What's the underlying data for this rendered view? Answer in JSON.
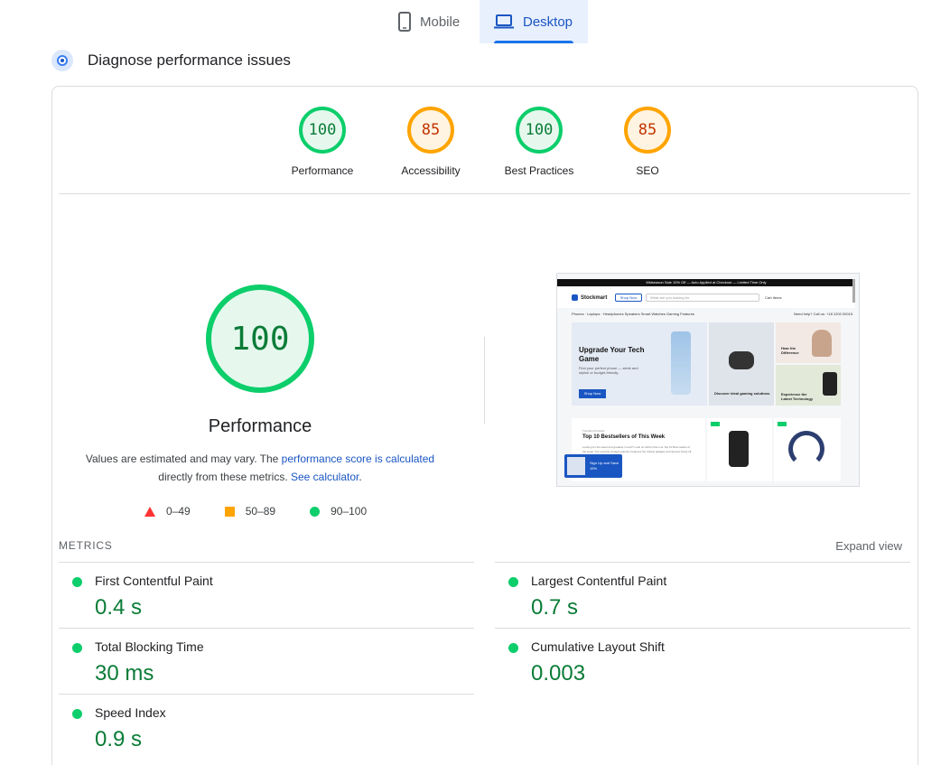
{
  "tabs": {
    "mobile_label": "Mobile",
    "desktop_label": "Desktop"
  },
  "diagnose": {
    "title": "Diagnose performance issues"
  },
  "scores": [
    {
      "label": "Performance",
      "value": "100",
      "color": "#0cce6b"
    },
    {
      "label": "Accessibility",
      "value": "85",
      "color": "#ffa400"
    },
    {
      "label": "Best Practices",
      "value": "100",
      "color": "#0cce6b"
    },
    {
      "label": "SEO",
      "value": "85",
      "color": "#ffa400"
    }
  ],
  "main_score": {
    "value": "100",
    "title": "Performance",
    "note_prefix": "Values are estimated and may vary. The ",
    "note_link1": "performance score is calculated",
    "note_middle": " directly from these metrics. ",
    "note_link2": "See calculator",
    "note_suffix": "."
  },
  "legend": {
    "fail": "0–49",
    "average": "50–89",
    "pass": "90–100"
  },
  "screenshot": {
    "top_banner": "Midseason Sale 10% Off — Auto Applied at Checkout — Limited Time Only",
    "logo": "Stockmart",
    "shop_now": "Shop Now",
    "search_placeholder": "What are you looking for",
    "nav_right": "Cart Items",
    "categories": "Phones ·  Laptops ·  Headphones  Speakers  Smart Watches  Gaming  Features",
    "help": "Need help? Call us: +18 1200 00015",
    "hero_title": "Upgrade Your Tech Game",
    "hero_sub": "Find your perfect phone — sleek and stylish or budget-friendly.",
    "hero_btn": "Shop Now",
    "mid_text": "Discover ideal gaming solutions",
    "r1_text": "Hear the Difference",
    "r2_text": "Experience the Latest Technology",
    "best_kicker": "Trending Products",
    "best_title": "Top 10 Bestsellers of This Week",
    "best_sub": "Looking for the latest and greatest in tech? Look no further than our Top 10 Best sellers of the week. Our expertly curated selection features the hottest gadgets and devices flying off the shelves.",
    "signup": "Sign Up and Save 15%"
  },
  "metrics": {
    "title": "METRICS",
    "expand_label": "Expand view",
    "items": [
      {
        "name": "First Contentful Paint",
        "value": "0.4 s"
      },
      {
        "name": "Largest Contentful Paint",
        "value": "0.7 s"
      },
      {
        "name": "Total Blocking Time",
        "value": "30 ms"
      },
      {
        "name": "Cumulative Layout Shift",
        "value": "0.003"
      },
      {
        "name": "Speed Index",
        "value": "0.9 s"
      }
    ]
  },
  "colors": {
    "pass": "#0cce6b",
    "average": "#ffa400",
    "fail": "#ff3333",
    "accent": "#1a73e8"
  }
}
